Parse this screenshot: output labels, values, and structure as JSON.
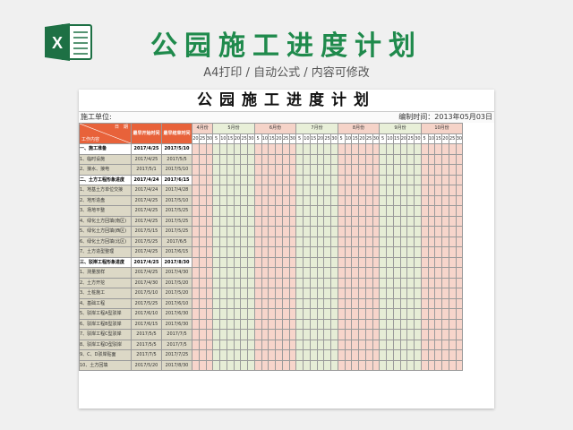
{
  "banner": {
    "title": "公园施工进度计划",
    "subtitle": "A4打印 / 自动公式 / 内容可修改",
    "logo_icon": "excel-icon",
    "logo_color": "#1d7044"
  },
  "sheet": {
    "title": "公园施工进度计划",
    "unit_label": "施工单位:",
    "date_label": "编制时间：2013年05月03日"
  },
  "header": {
    "corner_top": "日　期",
    "corner_bottom": "工作内容",
    "start_label": "最早开始时间",
    "end_label": "最早结束时间"
  },
  "months": [
    {
      "label": "4月份",
      "days": [
        "20",
        "25",
        "30"
      ]
    },
    {
      "label": "5月份",
      "days": [
        "5",
        "10",
        "15",
        "20",
        "25",
        "30"
      ]
    },
    {
      "label": "6月份",
      "days": [
        "5",
        "10",
        "15",
        "20",
        "25",
        "30"
      ]
    },
    {
      "label": "7月份",
      "days": [
        "5",
        "10",
        "15",
        "20",
        "25",
        "30"
      ]
    },
    {
      "label": "8月份",
      "days": [
        "5",
        "10",
        "15",
        "20",
        "25",
        "30"
      ]
    },
    {
      "label": "9月份",
      "days": [
        "5",
        "10",
        "15",
        "20",
        "25",
        "30"
      ]
    },
    {
      "label": "10月份",
      "days": [
        "5",
        "10",
        "15",
        "20",
        "25",
        "30"
      ]
    }
  ],
  "rows": [
    {
      "type": "section",
      "name": "一、施工准备",
      "start": "2017/4/25",
      "end": "2017/5/10"
    },
    {
      "type": "task",
      "name": "1、临时设施",
      "start": "2017/4/25",
      "end": "2017/5/5"
    },
    {
      "type": "task",
      "name": "2、接水、接电",
      "start": "2017/5/1",
      "end": "2017/5/10"
    },
    {
      "type": "section",
      "name": "二、土方工程形象进度",
      "start": "2017/4/24",
      "end": "2017/6/15"
    },
    {
      "type": "task",
      "name": "1、地基土方单位交接",
      "start": "2017/4/24",
      "end": "2017/4/28"
    },
    {
      "type": "task",
      "name": "2、地形造盘",
      "start": "2017/4/25",
      "end": "2017/5/10"
    },
    {
      "type": "task",
      "name": "3、场地平整",
      "start": "2017/4/25",
      "end": "2017/5/25"
    },
    {
      "type": "task",
      "name": "4、绿化土方回填(南区)",
      "start": "2017/4/25",
      "end": "2017/5/25"
    },
    {
      "type": "task",
      "name": "5、绿化土方回填(西区)",
      "start": "2017/5/15",
      "end": "2017/5/25"
    },
    {
      "type": "task",
      "name": "6、绿化土方回填(北区)",
      "start": "2017/5/25",
      "end": "2017/6/5"
    },
    {
      "type": "task",
      "name": "7、土方造型整理",
      "start": "2017/4/25",
      "end": "2017/6/15"
    },
    {
      "type": "section",
      "name": "三、驳岸工程形象进度",
      "start": "2017/4/25",
      "end": "2017/8/30"
    },
    {
      "type": "task",
      "name": "1、测量放样",
      "start": "2017/4/25",
      "end": "2017/4/30"
    },
    {
      "type": "task",
      "name": "2、土方开挖",
      "start": "2017/4/30",
      "end": "2017/5/20"
    },
    {
      "type": "task",
      "name": "3、土桩施工",
      "start": "2017/5/10",
      "end": "2017/5/20"
    },
    {
      "type": "task",
      "name": "4、基础工程",
      "start": "2017/5/25",
      "end": "2017/6/10"
    },
    {
      "type": "task",
      "name": "5、驳岸工程A型驳岸",
      "start": "2017/6/10",
      "end": "2017/6/30"
    },
    {
      "type": "task",
      "name": "6、驳岸工程B型驳岸",
      "start": "2017/6/15",
      "end": "2017/6/30"
    },
    {
      "type": "task",
      "name": "7、驳岸工程C型驳岸",
      "start": "2017/5/5",
      "end": "2017/7/5"
    },
    {
      "type": "task",
      "name": "8、驳岸工程D型驳岸",
      "start": "2017/5/5",
      "end": "2017/7/5"
    },
    {
      "type": "task",
      "name": "9、C、D驳岸贴面",
      "start": "2017/7/5",
      "end": "2017/7/25"
    },
    {
      "type": "task",
      "name": "10、土方回填",
      "start": "2017/5/20",
      "end": "2017/8/30"
    }
  ]
}
